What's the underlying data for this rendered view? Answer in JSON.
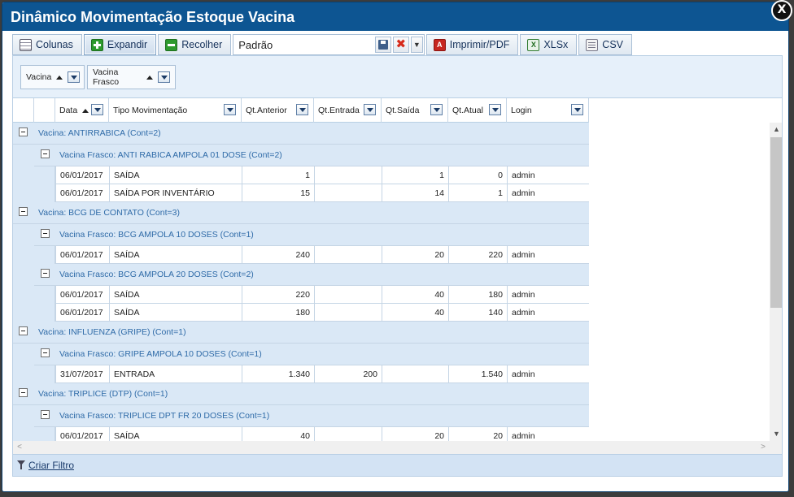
{
  "window": {
    "title": "Dinâmico Movimentação Estoque Vacina",
    "close_label": "X"
  },
  "toolbar": {
    "colunas": "Colunas",
    "expandir": "Expandir",
    "recolher": "Recolher",
    "layout_name": "Padrão",
    "imprimir": "Imprimir/PDF",
    "xlsx": "XLSx",
    "csv": "CSV",
    "pdf_icon_text": "A",
    "xls_icon_text": "X",
    "delete_symbol": "✖",
    "dropdown_symbol": "▼"
  },
  "group_panel": {
    "chips": [
      {
        "label": "Vacina"
      },
      {
        "label": "Vacina Frasco"
      }
    ]
  },
  "columns": [
    {
      "label": "Data",
      "sorted": "asc"
    },
    {
      "label": "Tipo Movimentação"
    },
    {
      "label": "Qt.Anterior"
    },
    {
      "label": "Qt.Entrada"
    },
    {
      "label": "Qt.Saída"
    },
    {
      "label": "Qt.Atual"
    },
    {
      "label": "Login"
    }
  ],
  "rows": [
    {
      "kind": "g1",
      "label": "Vacina: ANTIRRABICA (Cont=2)"
    },
    {
      "kind": "g2",
      "label": "Vacina Frasco: ANTI RABICA AMPOLA 01 DOSE (Cont=2)"
    },
    {
      "kind": "d",
      "cells": [
        "06/01/2017",
        "SAÍDA",
        "1",
        "",
        "1",
        "0",
        "admin"
      ]
    },
    {
      "kind": "d",
      "cells": [
        "06/01/2017",
        "SAÍDA POR INVENTÁRIO",
        "15",
        "",
        "14",
        "1",
        "admin"
      ]
    },
    {
      "kind": "g1",
      "label": "Vacina: BCG DE CONTATO (Cont=3)"
    },
    {
      "kind": "g2",
      "label": "Vacina Frasco: BCG AMPOLA 10 DOSES (Cont=1)"
    },
    {
      "kind": "d",
      "cells": [
        "06/01/2017",
        "SAÍDA",
        "240",
        "",
        "20",
        "220",
        "admin"
      ]
    },
    {
      "kind": "g2",
      "label": "Vacina Frasco: BCG AMPOLA 20 DOSES (Cont=2)"
    },
    {
      "kind": "d",
      "cells": [
        "06/01/2017",
        "SAÍDA",
        "220",
        "",
        "40",
        "180",
        "admin"
      ]
    },
    {
      "kind": "d",
      "cells": [
        "06/01/2017",
        "SAÍDA",
        "180",
        "",
        "40",
        "140",
        "admin"
      ]
    },
    {
      "kind": "g1",
      "label": "Vacina: INFLUENZA (GRIPE) (Cont=1)"
    },
    {
      "kind": "g2",
      "label": "Vacina Frasco: GRIPE AMPOLA 10 DOSES (Cont=1)"
    },
    {
      "kind": "d",
      "cells": [
        "31/07/2017",
        "ENTRADA",
        "1.340",
        "200",
        "",
        "1.540",
        "admin"
      ]
    },
    {
      "kind": "g1",
      "label": "Vacina: TRIPLICE (DTP) (Cont=1)"
    },
    {
      "kind": "g2",
      "label": "Vacina Frasco: TRIPLICE DPT FR 20 DOSES (Cont=1)"
    },
    {
      "kind": "d",
      "cells": [
        "06/01/2017",
        "SAÍDA",
        "40",
        "",
        "20",
        "20",
        "admin"
      ]
    }
  ],
  "scrollbar": {
    "up_arrow": "▲",
    "down_arrow": "▼",
    "left_arrow": "<",
    "right_arrow": ">"
  },
  "footer": {
    "criar_filtro": "Criar Filtro"
  }
}
